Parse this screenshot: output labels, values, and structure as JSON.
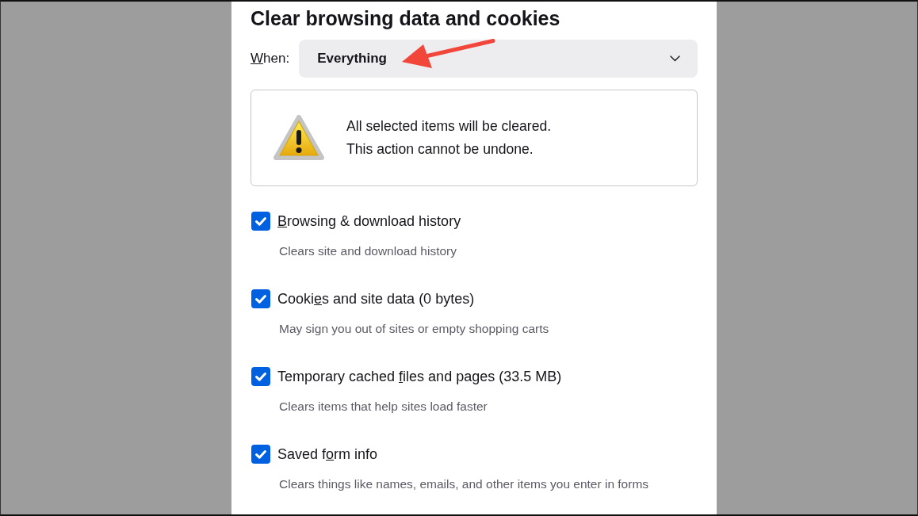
{
  "dialog": {
    "title": "Clear browsing data and cookies",
    "when": {
      "label": [
        {
          "text": "W",
          "underlined": true
        },
        {
          "text": "hen:",
          "underlined": false
        }
      ],
      "value": "Everything"
    },
    "warning": {
      "lines": [
        "All selected items will be cleared.",
        "This action cannot be undone."
      ]
    },
    "items": [
      {
        "label": [
          {
            "text": "B",
            "underlined": true
          },
          {
            "text": "rowsing & download history",
            "underlined": false
          }
        ],
        "description": "Clears site and download history",
        "checked": true
      },
      {
        "label": [
          {
            "text": "Cooki",
            "underlined": false
          },
          {
            "text": "e",
            "underlined": true
          },
          {
            "text": "s and site data (0 bytes)",
            "underlined": false
          }
        ],
        "description": "May sign you out of sites or empty shopping carts",
        "checked": true
      },
      {
        "label": [
          {
            "text": "Temporary cached ",
            "underlined": false
          },
          {
            "text": "f",
            "underlined": true
          },
          {
            "text": "iles and pages (33.5 MB)",
            "underlined": false
          }
        ],
        "description": "Clears items that help sites load faster",
        "checked": true
      },
      {
        "label": [
          {
            "text": "Saved f",
            "underlined": false
          },
          {
            "text": "o",
            "underlined": true
          },
          {
            "text": "rm info",
            "underlined": false
          }
        ],
        "description": "Clears things like names, emails, and other items you enter in forms",
        "checked": true
      }
    ]
  }
}
